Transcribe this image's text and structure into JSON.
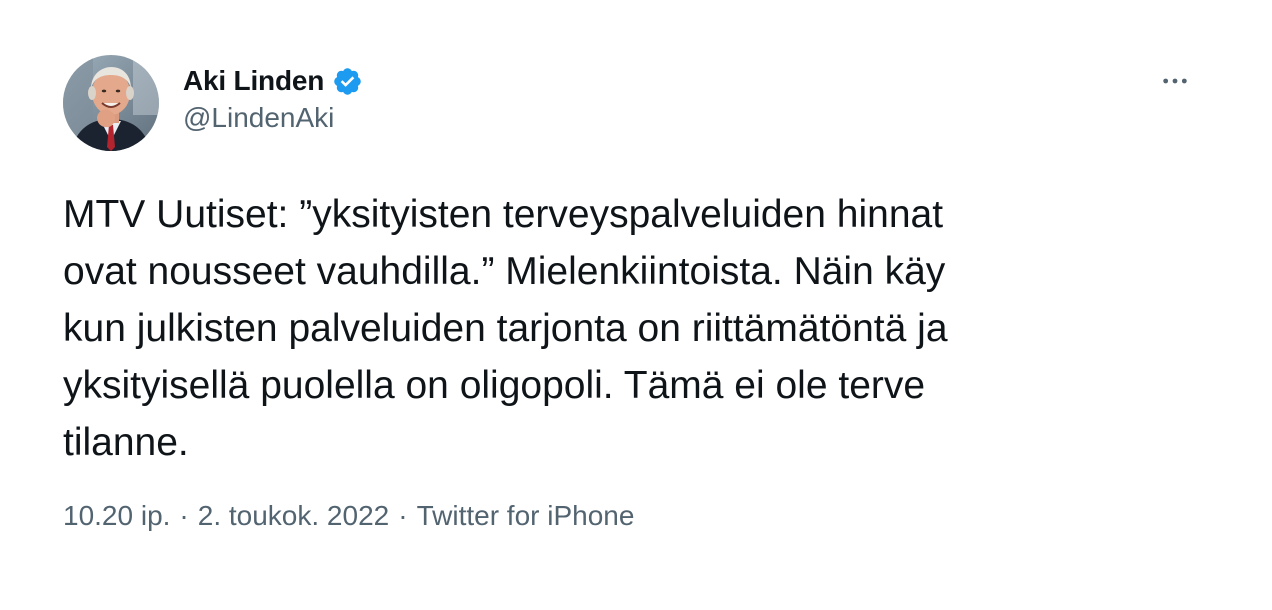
{
  "tweet": {
    "author": {
      "display_name": "Aki Linden",
      "handle": "@LindenAki",
      "verified": true,
      "avatar_icon": "profile-photo"
    },
    "text": "MTV Uutiset: ”yksityisten terveyspalveluiden hinnat\novat nousseet vauhdilla.” Mielenkiintoista. Näin käy\nkun julkisten palveluiden tarjonta on riittämätöntä ja\nyksityisellä puolella on oligopoli. Tämä ei ole terve\ntilanne.",
    "time": "10.20 ip.",
    "date": "2. toukok. 2022",
    "source": "Twitter for iPhone",
    "separator": "·",
    "more_icon": "more-horizontal-icon",
    "colors": {
      "verified_badge": "#1d9bf0",
      "secondary_text": "#536471",
      "primary_text": "#0f1419"
    }
  }
}
